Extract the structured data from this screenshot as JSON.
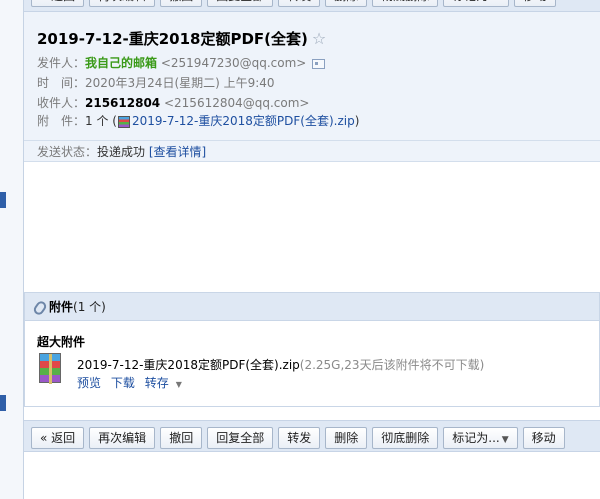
{
  "toolbar": {
    "back": "« 返回",
    "reedit": "再次编辑",
    "recall": "撤回",
    "reply_all": "回复全部",
    "forward": "转发",
    "delete": "删除",
    "delete_permanent": "彻底删除",
    "mark_as": "标记为...",
    "move": "移动"
  },
  "mail": {
    "subject": "2019-7-12-重庆2018定额PDF(全套)",
    "star": "☆",
    "from_label": "发件人：",
    "from_name": "我自己的邮箱",
    "from_addr": "<251947230@qq.com>",
    "time_label": "时　间：",
    "time_value": "2020年3月24日(星期二) 上午9:40",
    "to_label": "收件人：",
    "to_name": "215612804",
    "to_addr": "<215612804@qq.com>",
    "attach_label": "附　件：",
    "attach_count": "1 个 (",
    "attach_file": "2019-7-12-重庆2018定额PDF(全套).zip",
    "attach_close": ")",
    "status_label": "发送状态：",
    "status_value": "投递成功",
    "status_link": "[查看详情]"
  },
  "attachments": {
    "header_label": "附件",
    "header_count": "(1 个)",
    "section_title": "超大附件",
    "file_name": "2019-7-12-重庆2018定额PDF(全套).zip",
    "file_note": "(2.25G,23天后该附件将不可下载)",
    "preview": "预览",
    "download": "下载",
    "save_to": "转存"
  },
  "colors": {
    "toolbar_bg": "#dfe8f4",
    "header_bg": "#eef3fa",
    "link": "#1e4fa0",
    "sender_green": "#3a9a18"
  }
}
